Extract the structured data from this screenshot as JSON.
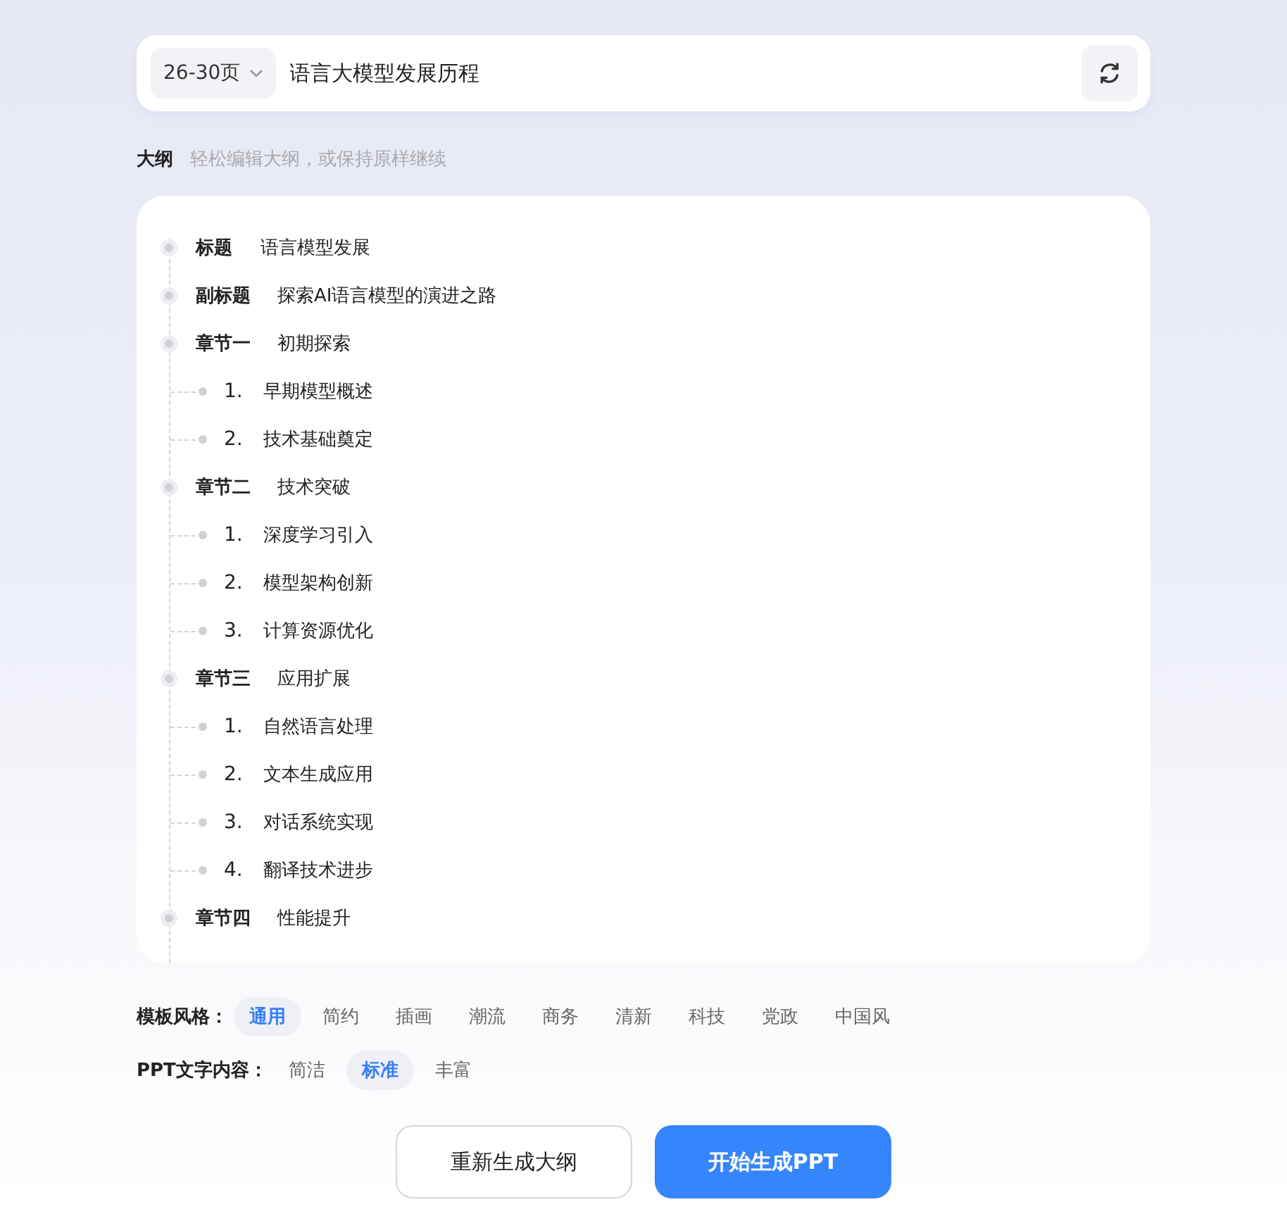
{
  "search": {
    "page_range": "26-30页",
    "value": "语言大模型发展历程"
  },
  "outline_header": {
    "title": "大纲",
    "hint": "轻松编辑大纲，或保持原样继续"
  },
  "outline": [
    {
      "label": "标题",
      "text": "语言模型发展"
    },
    {
      "label": "副标题",
      "text": "探索AI语言模型的演进之路"
    },
    {
      "label": "章节一",
      "text": "初期探索",
      "children": [
        {
          "number": "1.",
          "text": "早期模型概述"
        },
        {
          "number": "2.",
          "text": "技术基础奠定"
        }
      ]
    },
    {
      "label": "章节二",
      "text": "技术突破",
      "children": [
        {
          "number": "1.",
          "text": "深度学习引入"
        },
        {
          "number": "2.",
          "text": "模型架构创新"
        },
        {
          "number": "3.",
          "text": "计算资源优化"
        }
      ]
    },
    {
      "label": "章节三",
      "text": "应用扩展",
      "children": [
        {
          "number": "1.",
          "text": "自然语言处理"
        },
        {
          "number": "2.",
          "text": "文本生成应用"
        },
        {
          "number": "3.",
          "text": "对话系统实现"
        },
        {
          "number": "4.",
          "text": "翻译技术进步"
        }
      ]
    },
    {
      "label": "章节四",
      "text": "性能提升"
    }
  ],
  "template_style": {
    "label": "模板风格：",
    "options": [
      {
        "text": "通用",
        "selected": true
      },
      {
        "text": "简约",
        "selected": false
      },
      {
        "text": "插画",
        "selected": false
      },
      {
        "text": "潮流",
        "selected": false
      },
      {
        "text": "商务",
        "selected": false
      },
      {
        "text": "清新",
        "selected": false
      },
      {
        "text": "科技",
        "selected": false
      },
      {
        "text": "党政",
        "selected": false
      },
      {
        "text": "中国风",
        "selected": false
      }
    ]
  },
  "text_content": {
    "label": "PPT文字内容：",
    "options": [
      {
        "text": "简洁",
        "selected": false
      },
      {
        "text": "标准",
        "selected": true
      },
      {
        "text": "丰富",
        "selected": false
      }
    ]
  },
  "buttons": [
    {
      "kind": "secondary",
      "text": "重新生成大纲"
    },
    {
      "kind": "primary",
      "text": "开始生成PPT"
    }
  ]
}
